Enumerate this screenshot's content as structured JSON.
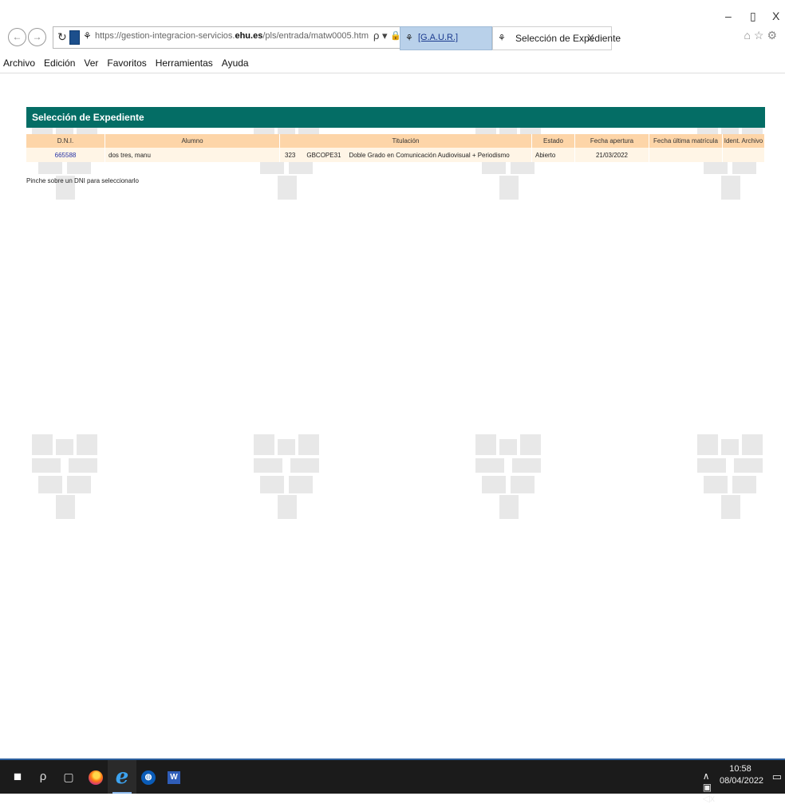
{
  "window": {
    "minimize": "–",
    "restore": "▯",
    "close": "X"
  },
  "toolbar": {
    "back": "←",
    "forward": "→",
    "refresh": "↻",
    "url_prefix": "https://gestion-integracion-servicios.",
    "url_domain": "ehu.es",
    "url_path": "/pls/entrada/matw0005.htm",
    "search_icon": "ρ ▾",
    "lock_icon": "🔒",
    "tabs": [
      {
        "label": "[G.A.U.R.]",
        "active": false
      },
      {
        "label": "Selección de Expediente",
        "active": true,
        "close": "X"
      }
    ],
    "right_icons": "⌂☆⚙"
  },
  "menu": [
    "Archivo",
    "Edición",
    "Ver",
    "Favoritos",
    "Herramientas",
    "Ayuda"
  ],
  "panel": {
    "title": "Selección de Expediente",
    "columns": [
      "D.N.I.",
      "Alumno",
      "Titulación",
      "Estado",
      "Fecha apertura",
      "Fecha última matrícula",
      "Ident. Archivo"
    ],
    "rows": [
      {
        "dni": "665588",
        "alumno": "dos tres, manu",
        "tit_code": "323",
        "tit_code2": "GBCOPE31",
        "tit_name": "Doble Grado en Comunicación Audiovisual + Periodismo",
        "estado": "Abierto",
        "fecha_apertura": "21/03/2022",
        "fecha_ultima": "",
        "ident": ""
      }
    ],
    "hint": "Pinche sobre un DNI para seleccionarlo"
  },
  "taskbar": {
    "start_icon": "■",
    "search_icon": "ρ",
    "taskview_icon": "▢",
    "ie_icon": "e",
    "word_label": "W",
    "tray_icons": "∧  ▣  ◁x",
    "time": "10:58",
    "date": "08/04/2022",
    "notify_icon": "▭"
  },
  "colors": {
    "panel_header": "#046d65",
    "column_header": "#fdd5a8",
    "row_bg": "#fff5e6",
    "link": "#2431a5",
    "watermark": "#e8e8e8"
  }
}
